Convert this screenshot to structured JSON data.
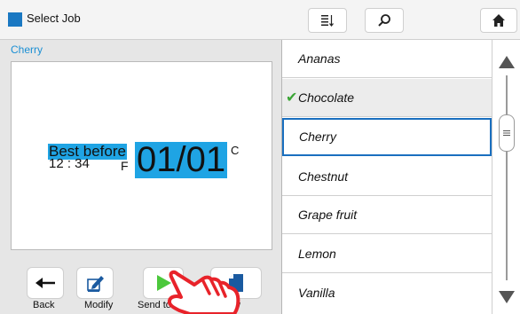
{
  "header": {
    "title": "Select Job",
    "buttons": [
      "sort-icon",
      "search-icon",
      "home-icon"
    ]
  },
  "job": {
    "name": "Cherry"
  },
  "preview": {
    "best_before": "Best before",
    "time": "12 : 34",
    "f_mark": "F",
    "date": "01/01",
    "c_mark": "C"
  },
  "toolbar": {
    "back": "Back",
    "modify": "Modify",
    "send": "Send to pr",
    "view": "w"
  },
  "job_list": {
    "items": [
      "Ananas",
      "Chocolate",
      "Cherry",
      "Chestnut",
      "Grape fruit",
      "Lemon",
      "Vanilla"
    ],
    "checked_item": "Chocolate",
    "selected_item": "Cherry"
  },
  "colors": {
    "accent": "#1a78c2",
    "highlight": "#1fa4e4",
    "check": "#3aa535",
    "hand": "#e8232a"
  }
}
